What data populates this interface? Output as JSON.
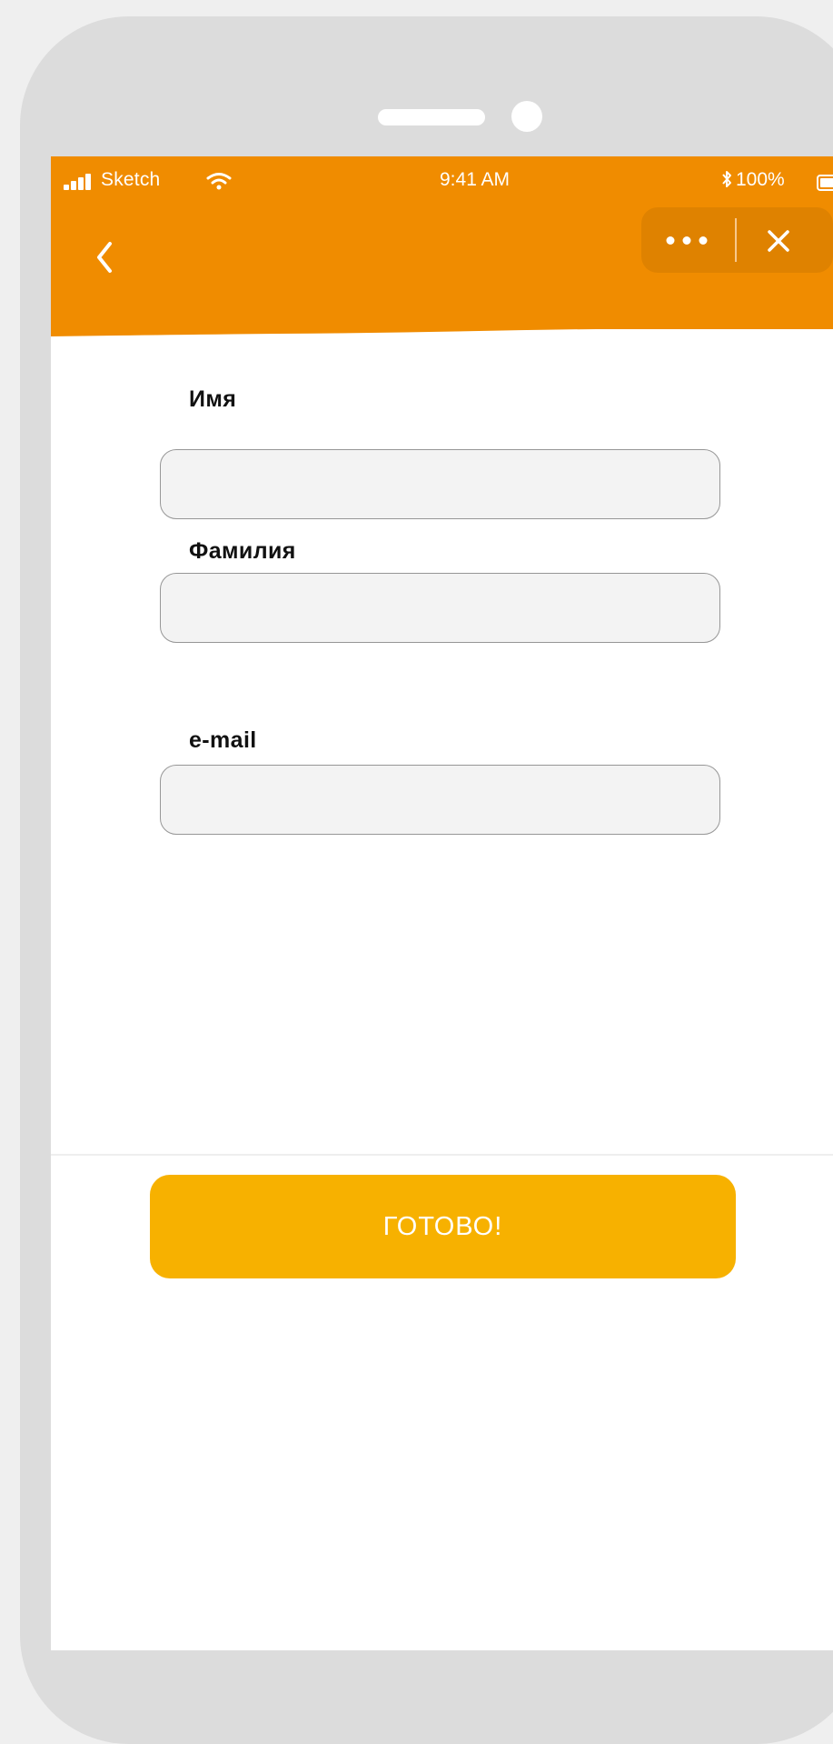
{
  "status_bar": {
    "carrier": "Sketch",
    "time": "9:41 AM",
    "battery": "100%"
  },
  "form": {
    "first_name": {
      "label": "Имя",
      "value": "",
      "placeholder": ""
    },
    "last_name": {
      "label": "Фамилия",
      "value": "",
      "placeholder": ""
    },
    "email": {
      "label": "e-mail",
      "value": "",
      "placeholder": ""
    }
  },
  "actions": {
    "submit_label": "ГОТОВО!"
  },
  "icons": {
    "back": "chevron-left-icon",
    "more": "more-dots-icon",
    "close": "close-icon",
    "signal": "signal-icon",
    "wifi": "wifi-icon",
    "bluetooth": "bluetooth-icon",
    "battery": "battery-icon"
  },
  "colors": {
    "header": "#f08c00",
    "header_capsule": "#df8200",
    "submit_button": "#f7b100",
    "input_background": "#f3f3f3",
    "input_border": "#969696",
    "frame": "#dcdcdc"
  }
}
